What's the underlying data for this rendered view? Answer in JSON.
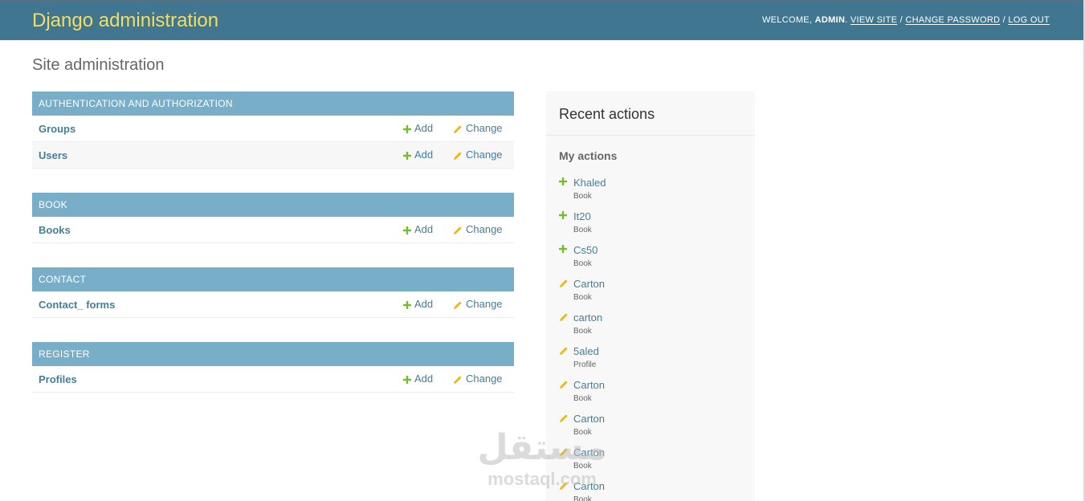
{
  "header": {
    "brand": "Django administration",
    "welcome": "WELCOME,",
    "username": "ADMIN",
    "view_site": "VIEW SITE",
    "change_password": "CHANGE PASSWORD",
    "log_out": "LOG OUT",
    "separator": "/"
  },
  "page_title": "Site administration",
  "links": {
    "add": "Add",
    "change": "Change"
  },
  "modules": [
    {
      "caption": "AUTHENTICATION AND AUTHORIZATION",
      "models": [
        "Groups",
        "Users"
      ]
    },
    {
      "caption": "BOOK",
      "models": [
        "Books"
      ]
    },
    {
      "caption": "CONTACT",
      "models": [
        "Contact_ forms"
      ]
    },
    {
      "caption": "REGISTER",
      "models": [
        "Profiles"
      ]
    }
  ],
  "recent": {
    "title": "Recent actions",
    "subtitle": "My actions",
    "actions": [
      {
        "kind": "add",
        "name": "Khaled",
        "type": "Book"
      },
      {
        "kind": "add",
        "name": "It20",
        "type": "Book"
      },
      {
        "kind": "add",
        "name": "Cs50",
        "type": "Book"
      },
      {
        "kind": "change",
        "name": "Carton",
        "type": "Book"
      },
      {
        "kind": "change",
        "name": "carton",
        "type": "Book"
      },
      {
        "kind": "change",
        "name": "5aled",
        "type": "Profile"
      },
      {
        "kind": "change",
        "name": "Carton",
        "type": "Book"
      },
      {
        "kind": "change",
        "name": "Carton",
        "type": "Book"
      },
      {
        "kind": "change",
        "name": "Carton",
        "type": "Book"
      },
      {
        "kind": "change",
        "name": "Carton",
        "type": "Book"
      }
    ]
  },
  "watermark": {
    "arabic": "مستقل",
    "latin": "mostaql.com"
  },
  "colors": {
    "header": "#417690",
    "brand": "#f5dd5d",
    "caption": "#79aec8",
    "link": "#447e9b",
    "add_icon": "#70bf2b",
    "change_icon": "#efb80b"
  },
  "icons": {
    "add": "plus-icon",
    "change": "pencil-icon"
  }
}
